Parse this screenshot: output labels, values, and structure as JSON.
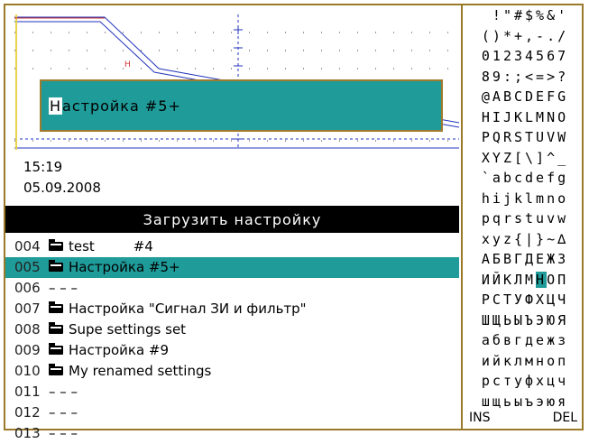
{
  "overlay": {
    "before_cursor": "",
    "cursor_char": "Н",
    "after_cursor": "астройка #5+"
  },
  "clock": {
    "time": "15:19",
    "date": "05.09.2008"
  },
  "header": {
    "title": "Загрузить настройку"
  },
  "list": [
    {
      "num": "004",
      "has_folder": true,
      "name": "test         #4",
      "selected": false
    },
    {
      "num": "005",
      "has_folder": true,
      "name": "Настройка #5+",
      "selected": true
    },
    {
      "num": "006",
      "has_folder": false,
      "name": "– – –",
      "selected": false
    },
    {
      "num": "007",
      "has_folder": true,
      "name": "Настройка \"Сигнал ЗИ и фильтр\"",
      "selected": false
    },
    {
      "num": "008",
      "has_folder": true,
      "name": "Supe settings set",
      "selected": false
    },
    {
      "num": "009",
      "has_folder": true,
      "name": "Настройка #9",
      "selected": false
    },
    {
      "num": "010",
      "has_folder": true,
      "name": "My renamed settings",
      "selected": false
    },
    {
      "num": "011",
      "has_folder": false,
      "name": "– – –",
      "selected": false
    },
    {
      "num": "012",
      "has_folder": false,
      "name": "– – –",
      "selected": false
    },
    {
      "num": "013",
      "has_folder": false,
      "name": "– – –",
      "selected": false
    }
  ],
  "charset": {
    "rows": [
      " !\"#$%&'",
      "()*+,-./",
      "01234567",
      "89:;<=>?",
      "@ABCDEFG",
      "HIJKLMNO",
      "PQRSTUVW",
      "XYZ[\\]^_",
      "`abcdefg",
      "hijklmno",
      "pqrstuvw",
      "xyz{|}~∆",
      "АБВГДЕЖЗ",
      "ИЙКЛМНОП",
      "РСТУФХЦЧ",
      "ШЩЬЫЪЭЮЯ",
      "абвгдежз",
      "ийклмноп",
      "рстуфхцч",
      "шщьыъэюя"
    ],
    "highlight_row": 13,
    "highlight_col": 5,
    "ins_label": "INS",
    "del_label": "DEL"
  },
  "colors": {
    "accent": "#1f9b99",
    "frame": "#9a7a2a",
    "header_bg": "#000000"
  }
}
